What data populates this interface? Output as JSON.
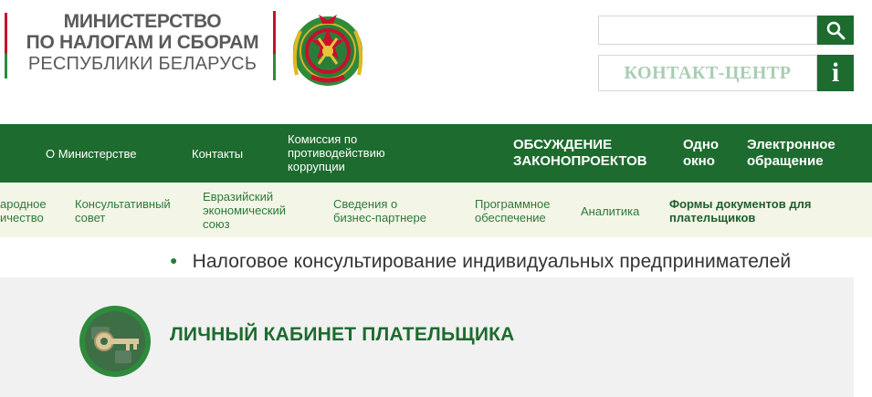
{
  "header": {
    "ministry_line1": "МИНИСТЕРСТВО",
    "ministry_line2": "ПО НАЛОГАМ И СБОРАМ",
    "ministry_line3": "РЕСПУБЛИКИ БЕЛАРУСЬ",
    "search_placeholder": "",
    "search_icon": "search-icon",
    "contact_center": "КОНТАКТ-ЦЕНТР",
    "info_label": "i"
  },
  "main_nav": {
    "about": "О Министерстве",
    "contacts": "Контакты",
    "commission_l1": "Комиссия по",
    "commission_l2": "противодействию",
    "commission_l3": "коррупции",
    "discussion_l1": "ОБСУЖДЕНИЕ",
    "discussion_l2": "ЗАКОНОПРОЕКТОВ",
    "one_window_l1": "Одно",
    "one_window_l2": "окно",
    "electronic_l1": "Электронное",
    "electronic_l2": "обращение"
  },
  "sub_nav": {
    "intl_l1": "ародное",
    "intl_l2": "ичество",
    "council_l1": "Консультативный",
    "council_l2": "совет",
    "eaeu_l1": "Евразийский",
    "eaeu_l2": "экономический",
    "eaeu_l3": "союз",
    "partner_l1": "Сведения о",
    "partner_l2": "бизнес-партнере",
    "software_l1": "Программное",
    "software_l2": "обеспечение",
    "analytics": "Аналитика",
    "forms_l1": "Формы документов для",
    "forms_l2": "плательщиков"
  },
  "content": {
    "headline": "Налоговое консультирование индивидуальных предпринимателей",
    "cabinet_title": "ЛИЧНЫЙ КАБИНЕТ ПЛАТЕЛЬЩИКА"
  },
  "colors": {
    "brand_green": "#1d6b2e",
    "subnav_bg": "#f3f5e6",
    "accent_red": "#c8102e"
  }
}
